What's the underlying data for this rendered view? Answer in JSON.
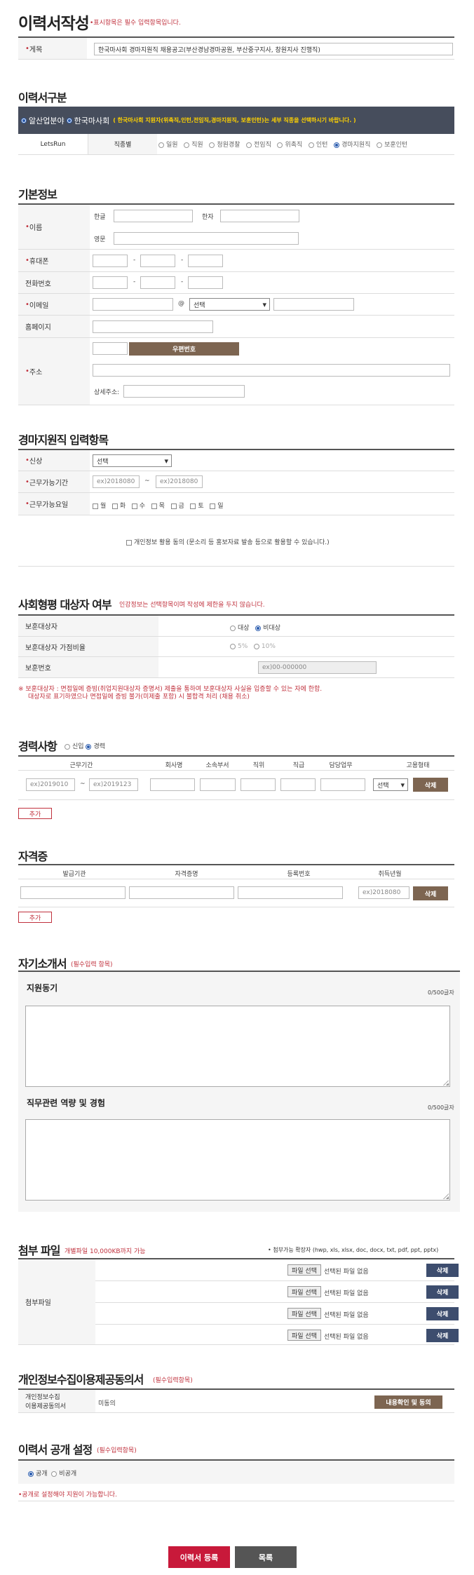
{
  "header": {
    "title": "이력서작성",
    "required_note": "•표시항목은 필수 입력항목입니다."
  },
  "notice": {
    "label": "게목",
    "value": "한국마사회 경마지원직 채용공고(부산경남경마공원, 부산중구지사, 창원지사 진행직)"
  },
  "resume_type": {
    "title": "이력서구분",
    "org1": "알산업분야",
    "org2": "한국마사회",
    "banner_note": "( 한국마사회 지원자(위촉직,인턴,전임직,경마지원직, 보훈인턴)는 세부 직종을 선택하시기 바랍니다. )",
    "company": "LetsRun",
    "category_label": "직종별",
    "options": [
      "일원",
      "직원",
      "청원경찰",
      "전임직",
      "위촉직",
      "인턴",
      "경마지원직",
      "보훈인턴"
    ],
    "selected": "경마지원직"
  },
  "basic": {
    "title": "기본정보",
    "name_label": "이름",
    "hangul": "한글",
    "hanja": "한자",
    "english": "영문",
    "mobile_label": "휴대폰",
    "phone_label": "전화번호",
    "email_label": "이메일",
    "at": "@",
    "email_select": "선택",
    "homepage_label": "홈페이지",
    "address_label": "주소",
    "zip_button": "우편번호",
    "detail_address": "상세주소:",
    "dash": "-"
  },
  "race": {
    "title": "경마지원직 입력항목",
    "status_label": "신상",
    "status_select": "선택",
    "period_label": "근무가능기간",
    "period_from": "ex)2018080",
    "period_to": "ex)2018080",
    "tilde": "~",
    "days_label": "근무가능요일",
    "days": [
      "월",
      "화",
      "수",
      "목",
      "금",
      "토",
      "일"
    ],
    "consent": "개인정보 활용 동의 (문소리 등 홍보자료 발송 등으로 활용할 수 있습니다.)"
  },
  "social": {
    "title": "사회형평 대상자 여부",
    "note": "인강정보는 선택항목이며 작성에 제한을 두지 않습니다.",
    "veteran_label": "보훈대상자",
    "yes": "대상",
    "no": "비대상",
    "ratio_label": "보훈대상자 가점비율",
    "ratio5": "5%",
    "ratio10": "10%",
    "number_label": "보훈번호",
    "number_placeholder": "ex)00-000000",
    "warn1": "※ 보훈대상자 : 면접일에 증빙(취업지원대상자 증명서) 제출을 통하여 보훈대상자 사실을 입증할 수 있는 자에 한함.",
    "warn2": "대상자로 표기하였으나 면접일에 증빙 불가(미제출 포함) 시 불합격 처리 (채용 취소)"
  },
  "career": {
    "title": "경력사항",
    "new": "신입",
    "exp": "경력",
    "headers": [
      "근무기간",
      "회사명",
      "소속부서",
      "직위",
      "직급",
      "담당업무",
      "고용형태"
    ],
    "from": "ex)2019010",
    "to": "ex)2019123",
    "select": "선택",
    "delete": "삭제",
    "add": "추가"
  },
  "license": {
    "title": "자격증",
    "headers": [
      "발급기관",
      "자격증명",
      "등록번호",
      "취득년월"
    ],
    "date": "ex)2018080",
    "delete": "삭제",
    "add": "추가"
  },
  "intro": {
    "title": "자기소개서",
    "note": "(필수입력 항목)",
    "motive": "지원동기",
    "motive_count": "0/500글자",
    "competence": "직무관련 역량 및 경험",
    "competence_count": "0/500글자"
  },
  "files": {
    "title": "첨부 파일",
    "note": "개별파일 10,000KB까지 가능",
    "ext": "• 첨부가능 확장자 (hwp, xls, xlsx, doc, docx, txt, pdf, ppt, pptx)",
    "label": "첨부파일",
    "choose": "파일 선택",
    "none": "선택된 파일 없음",
    "delete": "삭제"
  },
  "privacy": {
    "title": "개인정보수집이용제공동의서",
    "note": "(필수입력항목)",
    "label1": "개인정보수집",
    "label2": "이용제공동의서",
    "status": "미동의",
    "button": "내용확인 및 동의"
  },
  "public": {
    "title": "이력서 공개 설정",
    "note": "(필수입력항목)",
    "public": "공개",
    "private": "비공개",
    "warn": "•공개로 설정해야 지원이 가능합니다."
  },
  "footer": {
    "submit": "이력서 등록",
    "list": "목록"
  }
}
